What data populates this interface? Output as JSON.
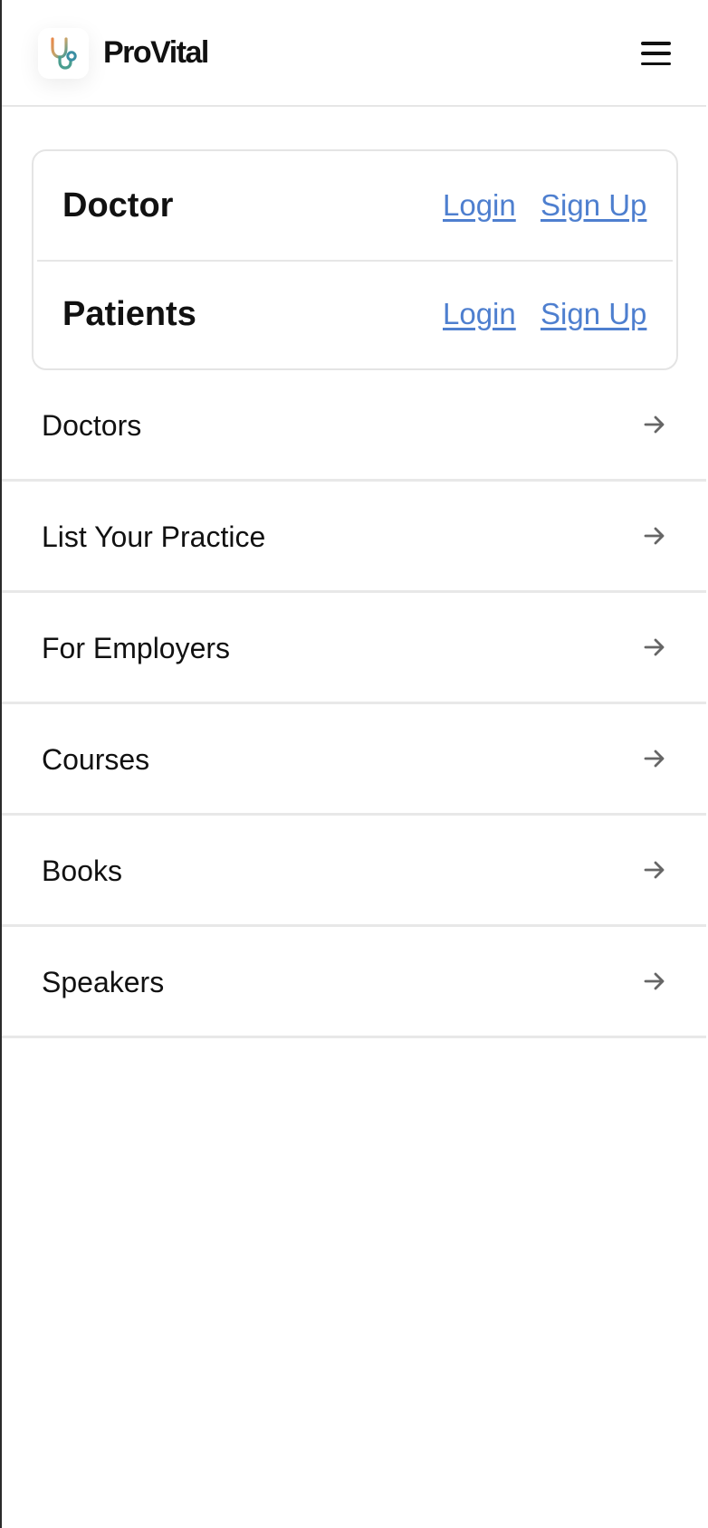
{
  "header": {
    "brand": "ProVital",
    "logo_icon": "stethoscope-icon",
    "menu_icon": "hamburger-menu-icon"
  },
  "auth": {
    "rows": [
      {
        "label": "Doctor",
        "login": "Login",
        "signup": "Sign Up"
      },
      {
        "label": "Patients",
        "login": "Login",
        "signup": "Sign Up"
      }
    ],
    "link_color": "#4e7fcf"
  },
  "nav": {
    "items": [
      {
        "label": "Doctors"
      },
      {
        "label": "List Your Practice"
      },
      {
        "label": "For Employers"
      },
      {
        "label": "Courses"
      },
      {
        "label": "Books"
      },
      {
        "label": "Speakers"
      }
    ],
    "arrow_icon": "arrow-right-icon"
  },
  "colors": {
    "text": "#111111",
    "divider": "#e6e6e6",
    "arrow": "#666666"
  }
}
